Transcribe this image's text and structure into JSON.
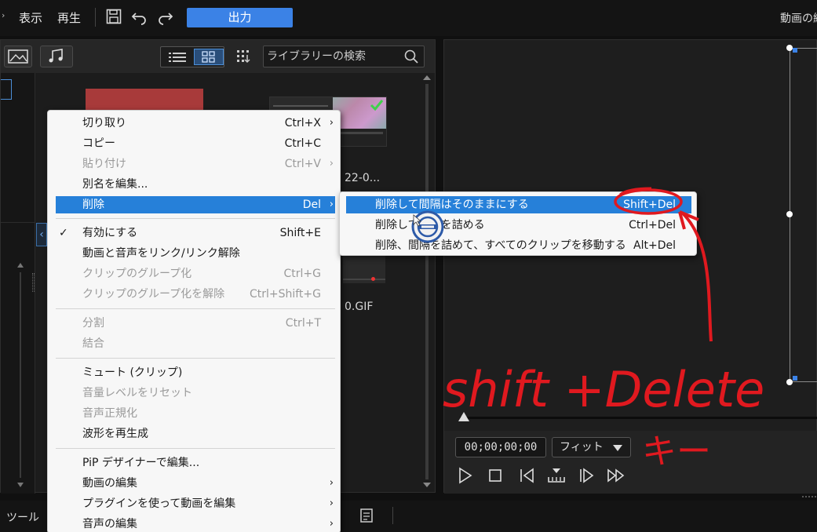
{
  "menubar": {
    "edge_glyph": "›",
    "view": "表示",
    "play": "再生",
    "output": "出力",
    "right_title": "動画の編"
  },
  "library": {
    "search_placeholder": "ライブラリーの検索",
    "clip_label_1": "22-0...",
    "clip_label_2": "0.GIF"
  },
  "context_menu": {
    "items": [
      {
        "label": "切り取り",
        "shortcut": "Ctrl+X",
        "arrow": "›"
      },
      {
        "label": "コピー",
        "shortcut": "Ctrl+C"
      },
      {
        "label": "貼り付け",
        "shortcut": "Ctrl+V",
        "arrow": "›"
      },
      {
        "label": "別名を編集..."
      },
      {
        "label": "削除",
        "shortcut": "Del",
        "arrow": "›"
      },
      {
        "label": "有効にする",
        "shortcut": "Shift+E",
        "check": "✓"
      },
      {
        "label": "動画と音声をリンク/リンク解除"
      },
      {
        "label": "クリップのグループ化",
        "shortcut": "Ctrl+G"
      },
      {
        "label": "クリップのグループ化を解除",
        "shortcut": "Ctrl+Shift+G"
      },
      {
        "label": "分割",
        "shortcut": "Ctrl+T"
      },
      {
        "label": "結合"
      },
      {
        "label": "ミュート (クリップ)"
      },
      {
        "label": "音量レベルをリセット"
      },
      {
        "label": "音声正規化"
      },
      {
        "label": "波形を再生成"
      },
      {
        "label": "PiP デザイナーで編集..."
      },
      {
        "label": "動画の編集",
        "arrow": "›"
      },
      {
        "label": "プラグインを使って動画を編集",
        "arrow": "›"
      },
      {
        "label": "音声の編集",
        "arrow": "›"
      }
    ]
  },
  "delete_submenu": {
    "items": [
      {
        "label": "削除して間隔はそのままにする",
        "shortcut": "Shift+Del"
      },
      {
        "label": "削除して間隔を詰める",
        "shortcut": "Ctrl+Del"
      },
      {
        "label": "削除、間隔を詰めて、すべてのクリップを移動する",
        "shortcut": "Alt+Del"
      }
    ]
  },
  "preview": {
    "timecode": "00;00;00;00",
    "fit": "フィット"
  },
  "bottom": {
    "tools": "ツール"
  },
  "annotation": {
    "line1": "shift +Delete",
    "line2": "キー",
    "color": "#e0191f"
  },
  "colors": {
    "accent": "#3b82e6",
    "menu_highlight": "#2680d9"
  }
}
